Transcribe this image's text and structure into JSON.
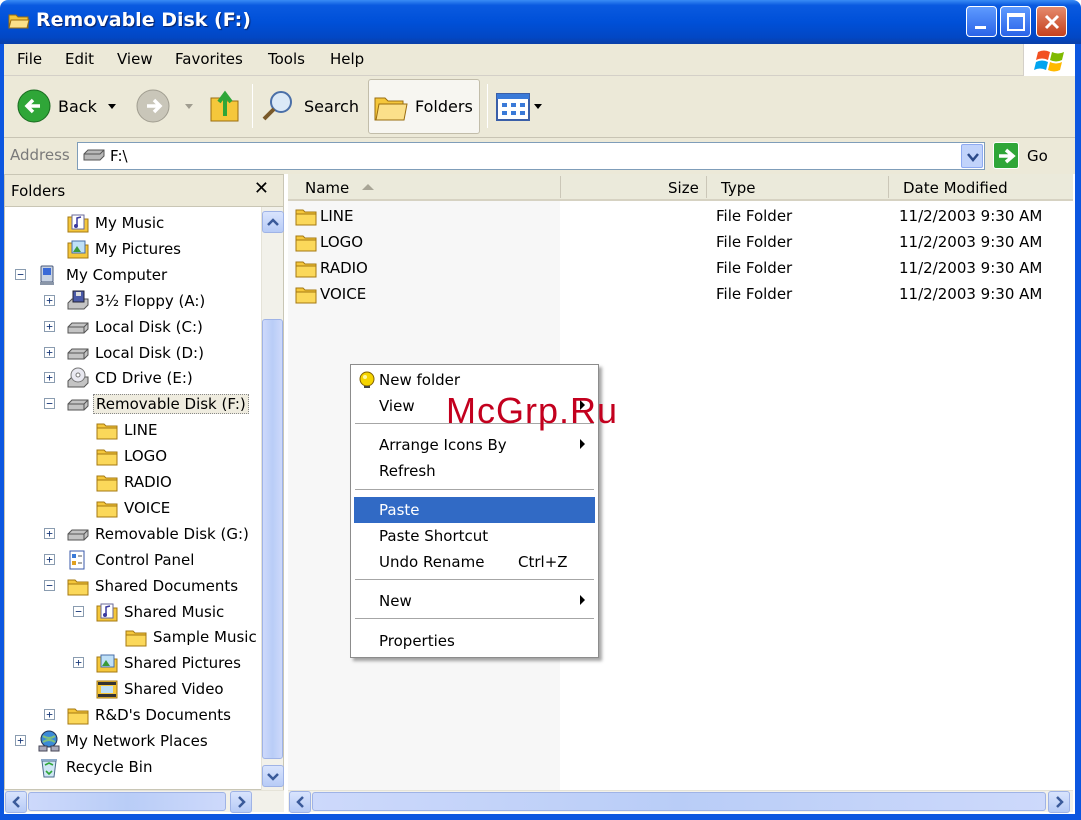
{
  "window": {
    "title": "Removable Disk (F:)"
  },
  "menubar": {
    "items": [
      "File",
      "Edit",
      "View",
      "Favorites",
      "Tools",
      "Help"
    ]
  },
  "toolbar": {
    "back_label": "Back",
    "search_label": "Search",
    "folders_label": "Folders"
  },
  "address": {
    "label": "Address",
    "value": "F:\\",
    "go_label": "Go"
  },
  "folders_pane": {
    "title": "Folders",
    "close_glyph": "✕",
    "items": [
      {
        "label": "My Music",
        "expander": ""
      },
      {
        "label": "My Pictures",
        "expander": ""
      },
      {
        "label": "My Computer",
        "expander": "−"
      },
      {
        "label": "3½ Floppy (A:)",
        "expander": "+"
      },
      {
        "label": "Local Disk (C:)",
        "expander": "+"
      },
      {
        "label": "Local Disk (D:)",
        "expander": "+"
      },
      {
        "label": "CD Drive (E:)",
        "expander": "+"
      },
      {
        "label": "Removable Disk (F:)",
        "expander": "−"
      },
      {
        "label": "LINE",
        "expander": ""
      },
      {
        "label": "LOGO",
        "expander": ""
      },
      {
        "label": "RADIO",
        "expander": ""
      },
      {
        "label": "VOICE",
        "expander": ""
      },
      {
        "label": "Removable Disk (G:)",
        "expander": "+"
      },
      {
        "label": "Control Panel",
        "expander": "+"
      },
      {
        "label": "Shared Documents",
        "expander": "−"
      },
      {
        "label": "Shared Music",
        "expander": "−"
      },
      {
        "label": "Sample Music",
        "expander": ""
      },
      {
        "label": "Shared Pictures",
        "expander": "+"
      },
      {
        "label": "Shared Video",
        "expander": ""
      },
      {
        "label": "R&D's Documents",
        "expander": "+"
      },
      {
        "label": "My Network Places",
        "expander": "+"
      },
      {
        "label": "Recycle Bin",
        "expander": ""
      }
    ]
  },
  "filelist": {
    "columns": {
      "name": "Name",
      "size": "Size",
      "type": "Type",
      "date": "Date Modified"
    },
    "rows": [
      {
        "name": "LINE",
        "size": "",
        "type": "File Folder",
        "date": "11/2/2003 9:30 AM"
      },
      {
        "name": "LOGO",
        "size": "",
        "type": "File Folder",
        "date": "11/2/2003 9:30 AM"
      },
      {
        "name": "RADIO",
        "size": "",
        "type": "File Folder",
        "date": "11/2/2003 9:30 AM"
      },
      {
        "name": "VOICE",
        "size": "",
        "type": "File Folder",
        "date": "11/2/2003 9:30 AM"
      }
    ]
  },
  "context_menu": {
    "items": [
      {
        "label": "New folder",
        "accel": "",
        "submenu": false
      },
      {
        "label": "View",
        "accel": "",
        "submenu": true
      },
      {
        "label": "Arrange Icons By",
        "accel": "",
        "submenu": true
      },
      {
        "label": "Refresh",
        "accel": "",
        "submenu": false
      },
      {
        "label": "Paste",
        "accel": "",
        "submenu": false,
        "highlighted": true
      },
      {
        "label": "Paste Shortcut",
        "accel": "",
        "submenu": false
      },
      {
        "label": "Undo Rename",
        "accel": "Ctrl+Z",
        "submenu": false
      },
      {
        "label": "New",
        "accel": "",
        "submenu": true
      },
      {
        "label": "Properties",
        "accel": "",
        "submenu": false
      }
    ]
  },
  "watermark": "McGrp.Ru",
  "colors": {
    "titlebar": "#0050d8",
    "highlight": "#316ac5",
    "chrome": "#ece9d8",
    "folder": "#f5c73b"
  }
}
